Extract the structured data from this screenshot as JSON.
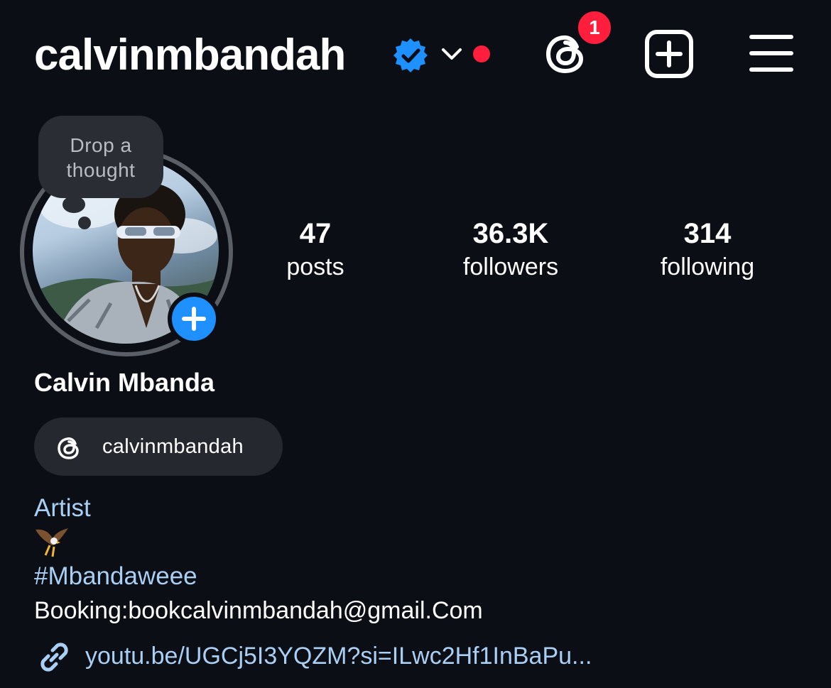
{
  "header": {
    "username": "calvinmbandah",
    "threads_badge_count": "1",
    "accent_blue": "#1e90ff",
    "notification_red": "#ff1f3d"
  },
  "avatar": {
    "thought_bubble_text": "Drop a thought",
    "icons": [
      "add-story-icon"
    ]
  },
  "stats": {
    "posts": {
      "value": "47",
      "label": "posts"
    },
    "followers": {
      "value": "36.3K",
      "label": "followers"
    },
    "following": {
      "value": "314",
      "label": "following"
    }
  },
  "bio": {
    "full_name": "Calvin Mbanda",
    "threads_handle": "calvinmbandah",
    "category": "Artist",
    "emoji": "🦅",
    "hashtag": "#Mbandaweee",
    "booking": "Booking:bookcalvinmbandah@gmail.Com",
    "link": "youtu.be/UGCj5I3YQZM?si=ILwc2Hf1InBaPu..."
  }
}
